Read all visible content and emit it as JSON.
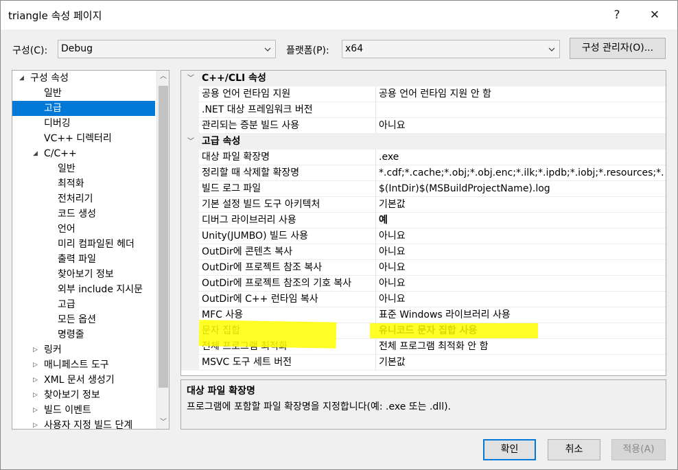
{
  "window": {
    "title": "triangle 속성 페이지",
    "help_glyph": "?",
    "close_glyph": "✕"
  },
  "toolbar": {
    "config_label": "구성(C):",
    "config_value": "Debug",
    "platform_label": "플랫폼(P):",
    "platform_value": "x64",
    "config_manager_label": "구성 관리자(O)..."
  },
  "tree": {
    "items": [
      {
        "label": "구성 속성",
        "level": 0,
        "expander": "◢"
      },
      {
        "label": "일반",
        "level": 1,
        "expander": ""
      },
      {
        "label": "고급",
        "level": 1,
        "expander": "",
        "selected": true
      },
      {
        "label": "디버깅",
        "level": 1,
        "expander": ""
      },
      {
        "label": "VC++ 디렉터리",
        "level": 1,
        "expander": ""
      },
      {
        "label": "C/C++",
        "level": 1,
        "expander": "◢"
      },
      {
        "label": "일반",
        "level": 2,
        "expander": ""
      },
      {
        "label": "최적화",
        "level": 2,
        "expander": ""
      },
      {
        "label": "전처리기",
        "level": 2,
        "expander": ""
      },
      {
        "label": "코드 생성",
        "level": 2,
        "expander": ""
      },
      {
        "label": "언어",
        "level": 2,
        "expander": ""
      },
      {
        "label": "미리 컴파일된 헤더",
        "level": 2,
        "expander": ""
      },
      {
        "label": "출력 파일",
        "level": 2,
        "expander": ""
      },
      {
        "label": "찾아보기 정보",
        "level": 2,
        "expander": ""
      },
      {
        "label": "외부 include 지시문",
        "level": 2,
        "expander": ""
      },
      {
        "label": "고급",
        "level": 2,
        "expander": ""
      },
      {
        "label": "모든 옵션",
        "level": 2,
        "expander": ""
      },
      {
        "label": "명령줄",
        "level": 2,
        "expander": ""
      },
      {
        "label": "링커",
        "level": 1,
        "expander": "▷"
      },
      {
        "label": "매니페스트 도구",
        "level": 1,
        "expander": "▷"
      },
      {
        "label": "XML 문서 생성기",
        "level": 1,
        "expander": "▷"
      },
      {
        "label": "찾아보기 정보",
        "level": 1,
        "expander": "▷"
      },
      {
        "label": "빌드 이벤트",
        "level": 1,
        "expander": "▷"
      },
      {
        "label": "사용자 지정 빌드 단계",
        "level": 1,
        "expander": "▷"
      }
    ]
  },
  "grid": {
    "rows": [
      {
        "type": "category",
        "name": "C++/CLI 속성"
      },
      {
        "type": "prop",
        "name": "공용 언어 런타임 지원",
        "value": "공용 언어 런타임 지원 안 함"
      },
      {
        "type": "prop",
        "name": ".NET 대상 프레임워크 버전",
        "value": ""
      },
      {
        "type": "prop",
        "name": "관리되는 증분 빌드 사용",
        "value": "아니요"
      },
      {
        "type": "category",
        "name": "고급 속성"
      },
      {
        "type": "prop",
        "name": "대상 파일 확장명",
        "value": ".exe"
      },
      {
        "type": "prop",
        "name": "정리할 때 삭제할 확장명",
        "value": "*.cdf;*.cache;*.obj;*.obj.enc;*.ilk;*.ipdb;*.iobj;*.resources;*.tlb;*.tli;"
      },
      {
        "type": "prop",
        "name": "빌드 로그 파일",
        "value": "$(IntDir)$(MSBuildProjectName).log"
      },
      {
        "type": "prop",
        "name": "기본 설정 빌드 도구 아키텍처",
        "value": "기본값"
      },
      {
        "type": "prop",
        "name": "디버그 라이브러리 사용",
        "value": "예",
        "bold": true
      },
      {
        "type": "prop",
        "name": "Unity(JUMBO) 빌드 사용",
        "value": "아니요"
      },
      {
        "type": "prop",
        "name": "OutDir에 콘텐츠 복사",
        "value": "아니요"
      },
      {
        "type": "prop",
        "name": "OutDir에 프로젝트 참조 복사",
        "value": "아니요"
      },
      {
        "type": "prop",
        "name": "OutDir에 프로젝트 참조의 기호 복사",
        "value": "아니요"
      },
      {
        "type": "prop",
        "name": "OutDir에 C++ 런타임 복사",
        "value": "아니요"
      },
      {
        "type": "prop",
        "name": "MFC 사용",
        "value": "표준 Windows 라이브러리 사용"
      },
      {
        "type": "prop",
        "name": "문자 집합",
        "value": "유니코드 문자 집합 사용",
        "bold": true
      },
      {
        "type": "prop",
        "name": "전체 프로그램 최적화",
        "value": "전체 프로그램 최적화 안 함"
      },
      {
        "type": "prop",
        "name": "MSVC 도구 세트 버전",
        "value": "기본값"
      }
    ]
  },
  "description": {
    "title": "대상 파일 확장명",
    "text": "프로그램에 포함할 파일 확장명을 지정합니다(예: .exe 또는 .dll)."
  },
  "footer": {
    "ok_label": "확인",
    "cancel_label": "취소",
    "apply_label": "적용(A)"
  },
  "colors": {
    "selection": "#0078d7",
    "highlight": "#ffff00"
  }
}
